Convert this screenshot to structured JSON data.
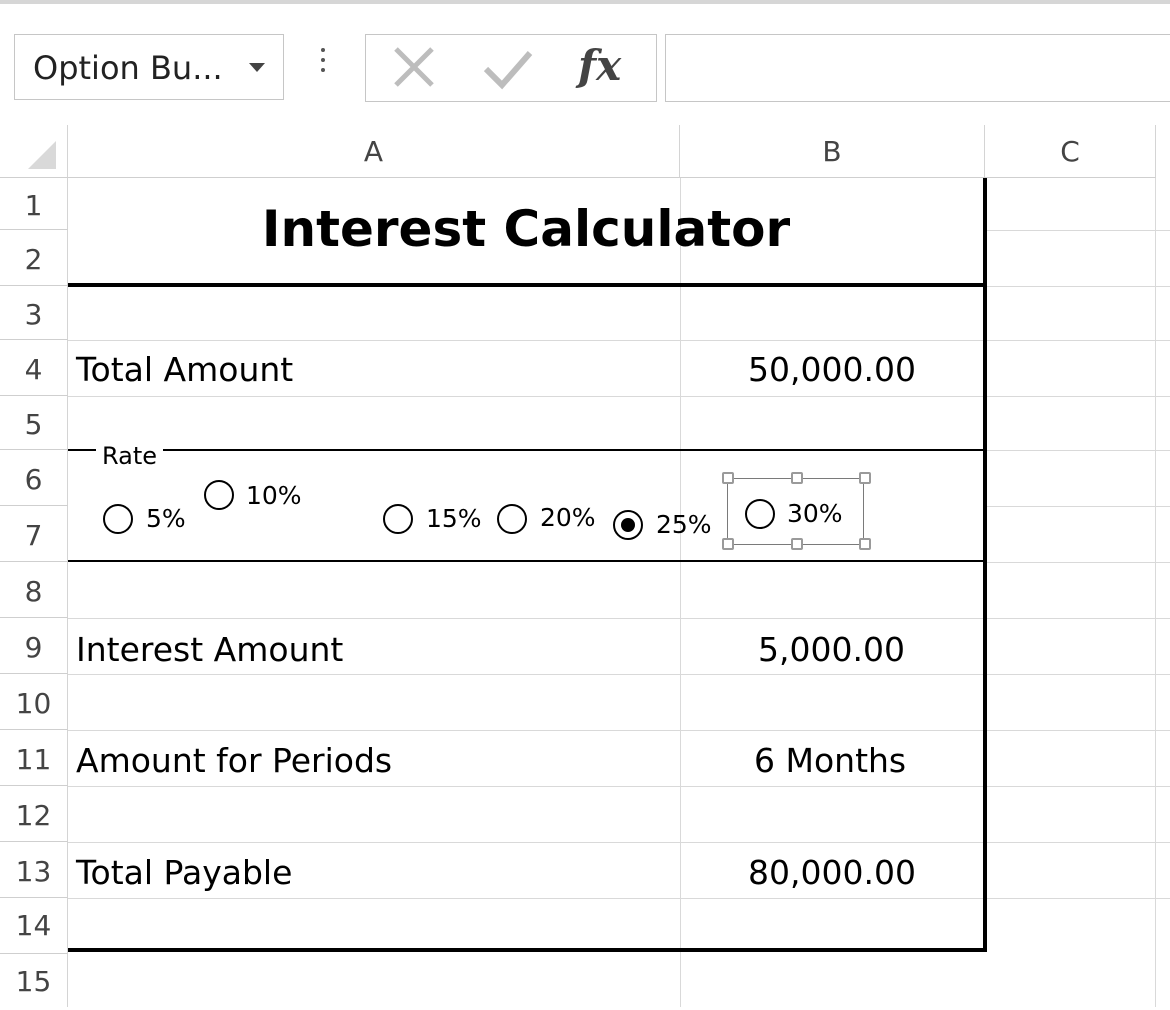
{
  "name_box": {
    "value": "Option Bu..."
  },
  "formula_bar": {
    "cancel_icon": "x-icon",
    "enter_icon": "check-icon",
    "fx_label": "fx",
    "value": ""
  },
  "columns": [
    "A",
    "B",
    "C"
  ],
  "rows": [
    "1",
    "2",
    "3",
    "4",
    "5",
    "6",
    "7",
    "8",
    "9",
    "10",
    "11",
    "12",
    "13",
    "14",
    "15"
  ],
  "sheet": {
    "title": "Interest Calculator",
    "total_amount": {
      "label": "Total Amount",
      "value": "50,000.00"
    },
    "interest_amount": {
      "label": "Interest Amount",
      "value": "5,000.00"
    },
    "periods": {
      "label": "Amount for Periods",
      "value": "6 Months"
    },
    "total_payable": {
      "label": "Total Payable",
      "value": "80,000.00"
    }
  },
  "rate_group": {
    "label": "Rate",
    "options": [
      {
        "label": "5%",
        "selected": false
      },
      {
        "label": "10%",
        "selected": false
      },
      {
        "label": "15%",
        "selected": false
      },
      {
        "label": "20%",
        "selected": false
      },
      {
        "label": "25%",
        "selected": true
      },
      {
        "label": "30%",
        "selected": false
      }
    ]
  }
}
